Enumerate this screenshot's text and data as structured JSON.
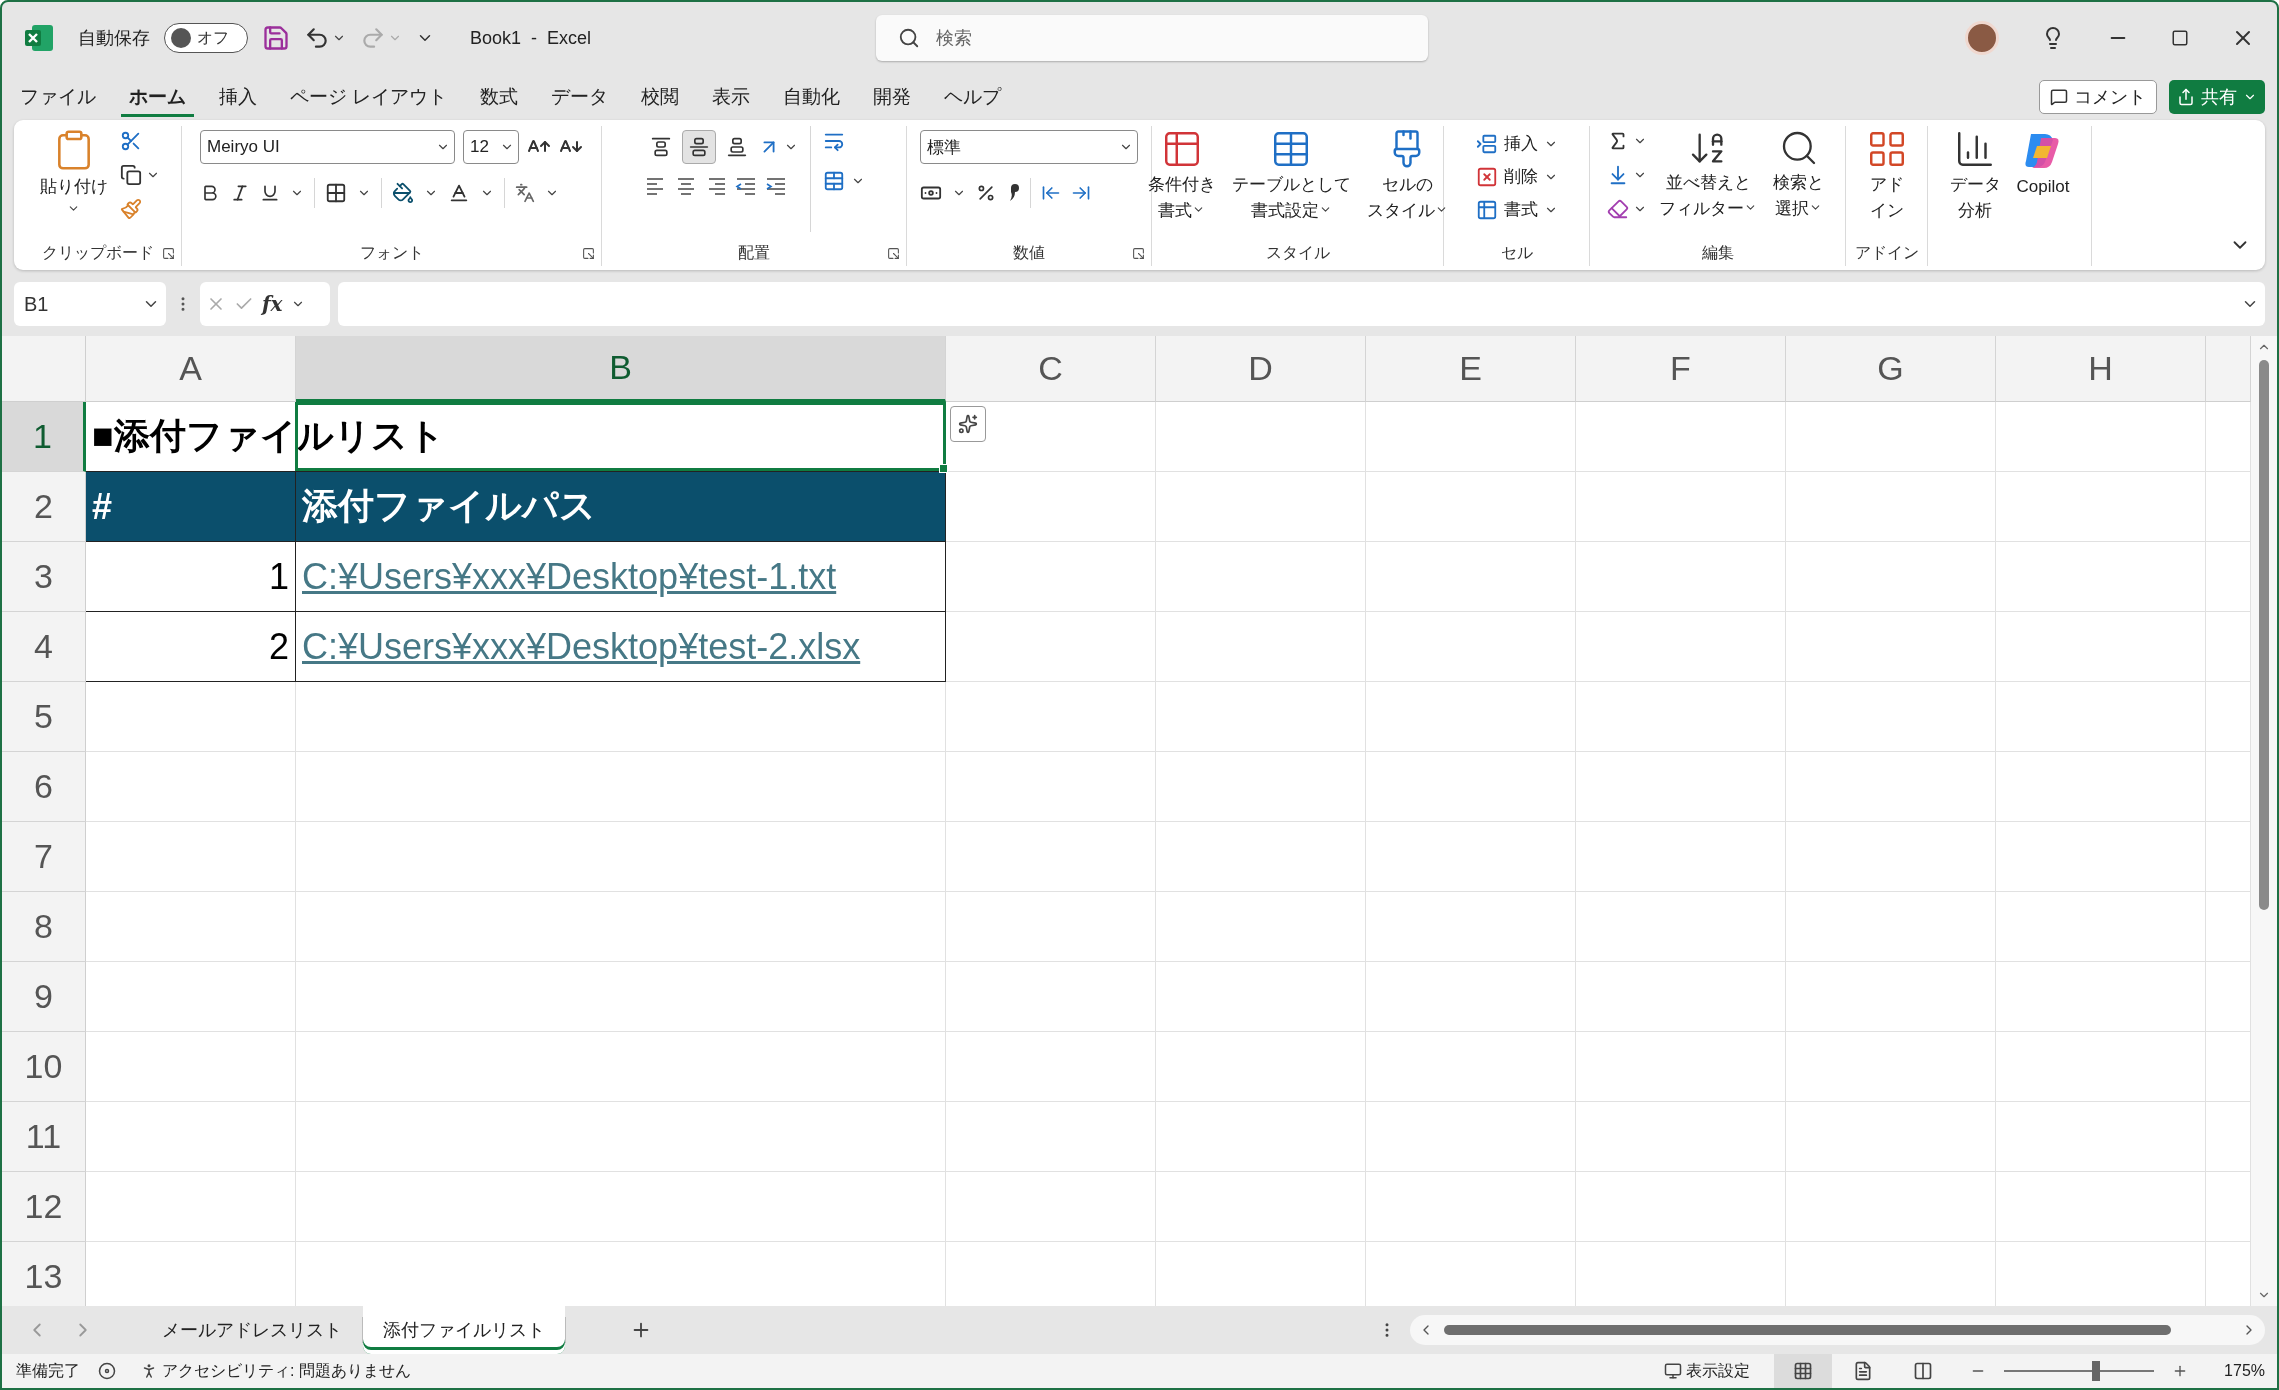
{
  "title_bar": {
    "autosave": {
      "label": "自動保存",
      "on": false,
      "state": "オフ"
    },
    "document_title": "Book1  -  Excel",
    "search": {
      "placeholder": "検索"
    }
  },
  "tabs": [
    {
      "label": "ファイル",
      "selected": false
    },
    {
      "label": "ホーム",
      "selected": true
    },
    {
      "label": "挿入",
      "selected": false
    },
    {
      "label": "ページ レイアウト",
      "selected": false
    },
    {
      "label": "数式",
      "selected": false
    },
    {
      "label": "データ",
      "selected": false
    },
    {
      "label": "校閲",
      "selected": false
    },
    {
      "label": "表示",
      "selected": false
    },
    {
      "label": "自動化",
      "selected": false
    },
    {
      "label": "開発",
      "selected": false
    },
    {
      "label": "ヘルプ",
      "selected": false
    }
  ],
  "actions": {
    "comment": "コメント",
    "share": "共有"
  },
  "ribbon": {
    "clipboard": {
      "label": "クリップボード",
      "paste": "貼り付け"
    },
    "font": {
      "label": "フォント",
      "name": "Meiryo UI",
      "size": "12"
    },
    "alignment": {
      "label": "配置",
      "vertical": [
        {
          "selected": false
        },
        {
          "selected": true
        },
        {
          "selected": false
        }
      ]
    },
    "number": {
      "label": "数値",
      "format": "標準"
    },
    "styles": {
      "label": "スタイル",
      "buttons": [
        {
          "lines": [
            "条件付き",
            "書式"
          ],
          "menu": true
        },
        {
          "lines": [
            "テーブルとして",
            "書式設定"
          ],
          "menu": true
        },
        {
          "lines": [
            "セルの",
            "スタイル"
          ],
          "menu": true
        }
      ]
    },
    "cells": {
      "label": "セル",
      "buttons": [
        "挿入",
        "削除",
        "書式"
      ]
    },
    "editing": {
      "label": "編集",
      "buttons": [
        {
          "lines": [
            "並べ替えと",
            "フィルター"
          ],
          "menu": true
        },
        {
          "lines": [
            "検索と",
            "選択"
          ],
          "menu": true
        }
      ]
    },
    "addins": {
      "label": "アドイン",
      "buttons": [
        {
          "lines": [
            "アド",
            "イン"
          ],
          "menu": false
        }
      ]
    },
    "extra": {
      "buttons": [
        {
          "lines": [
            "データ",
            "分析"
          ],
          "menu": false
        },
        {
          "lines": [
            "Copilot"
          ],
          "menu": false
        }
      ]
    }
  },
  "formula_bar": {
    "name_box": "B1",
    "function_label": "fx"
  },
  "sheet": {
    "columns": [
      {
        "label": "A",
        "selected": false
      },
      {
        "label": "B",
        "selected": true
      },
      {
        "label": "C",
        "selected": false
      },
      {
        "label": "D",
        "selected": false
      },
      {
        "label": "E",
        "selected": false
      },
      {
        "label": "F",
        "selected": false
      },
      {
        "label": "G",
        "selected": false
      },
      {
        "label": "H",
        "selected": false
      }
    ],
    "rows": [
      {
        "label": "1",
        "selected": true
      },
      {
        "label": "2",
        "selected": false
      },
      {
        "label": "3",
        "selected": false
      },
      {
        "label": "4",
        "selected": false
      },
      {
        "label": "5",
        "selected": false
      },
      {
        "label": "6",
        "selected": false
      },
      {
        "label": "7",
        "selected": false
      },
      {
        "label": "8",
        "selected": false
      },
      {
        "label": "9",
        "selected": false
      },
      {
        "label": "10",
        "selected": false
      },
      {
        "label": "11",
        "selected": false
      },
      {
        "label": "12",
        "selected": false
      },
      {
        "label": "13",
        "selected": false
      }
    ],
    "title": "■添付ファイルリスト",
    "header": [
      "#",
      "添付ファイルパス"
    ],
    "entries": [
      {
        "number": "1",
        "path": "C:¥Users¥xxx¥Desktop¥test-1.txt"
      },
      {
        "number": "2",
        "path": "C:¥Users¥xxx¥Desktop¥test-2.xlsx"
      }
    ]
  },
  "sheet_tabs": [
    {
      "label": "メールアドレスリスト",
      "selected": false
    },
    {
      "label": "添付ファイルリスト",
      "selected": true
    }
  ],
  "status_bar": {
    "ready": "準備完了",
    "accessibility": "アクセシビリティ: 問題ありません",
    "display_settings": "表示設定",
    "views": [
      {
        "selected": true
      },
      {
        "selected": false
      },
      {
        "selected": false
      }
    ],
    "zoom": {
      "level": 0.61,
      "reading": "175%"
    }
  }
}
